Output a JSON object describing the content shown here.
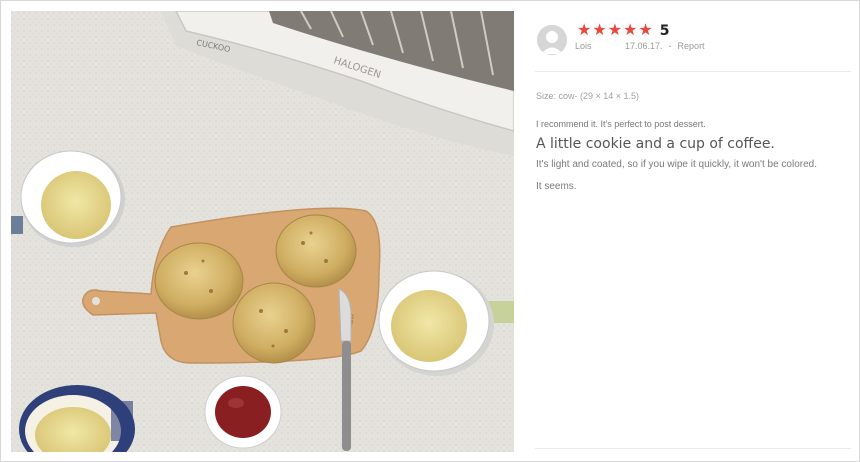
{
  "review": {
    "rating_stars": 5,
    "score": "5",
    "user_name": "Lois",
    "date": "17.06.17.",
    "report_label": "Report",
    "separator": "-",
    "size_label": "Size: cow- (29 × 14 × 1.5)",
    "recommend": "I recommend it. It's perfect to post dessert.",
    "title": "A little cookie and a cup of coffee.",
    "line1": "It's light and coated, so if you wipe it quickly, it won't be colored.",
    "line2": "It seems."
  },
  "photo": {
    "toaster_brand": "CUCKOO",
    "toaster_label": "HALOGEN",
    "description_colors": {
      "counter": "#e3e1dc",
      "board": "#d9a771",
      "scone": "#d6b86e",
      "tea": "#e6d58a",
      "jam": "#8a1f22"
    }
  },
  "colors": {
    "star": "#e8483f"
  }
}
